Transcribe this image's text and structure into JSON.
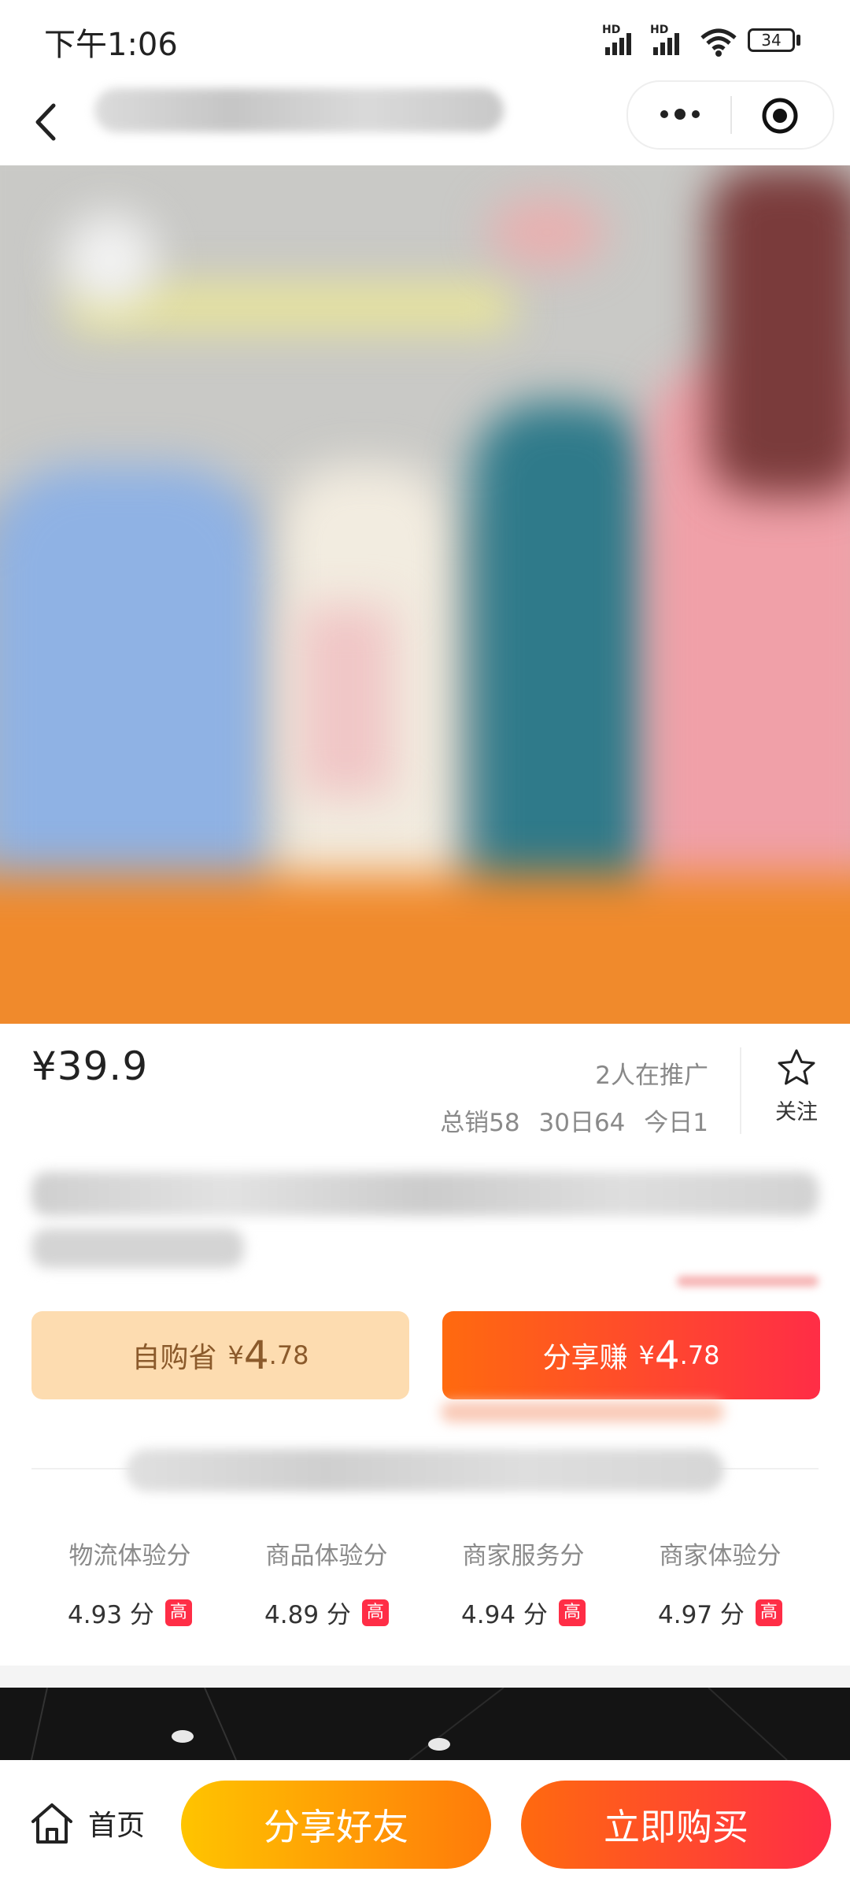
{
  "status_bar": {
    "time": "下午1:06",
    "battery": "34",
    "signal_tag": "HD"
  },
  "nav": {
    "back_icon": "chevron-left-icon",
    "more_icon": "more-dots-icon",
    "close_icon": "target-circle-icon"
  },
  "product": {
    "price": "¥39.9",
    "promoters": "2人在推广",
    "sales_total": "总销58",
    "sales_30d": "30日64",
    "sales_today": "今日1",
    "favorite_label": "关注",
    "favorite_icon": "star-outline-icon"
  },
  "actions": {
    "self_buy_label": "自购省",
    "self_buy_currency": "¥",
    "self_buy_int": "4",
    "self_buy_dec": ".78",
    "share_label": "分享赚",
    "share_currency": "¥",
    "share_int": "4",
    "share_dec": ".78"
  },
  "scores": [
    {
      "name": "物流体验分",
      "value": "4.93 分",
      "badge": "高"
    },
    {
      "name": "商品体验分",
      "value": "4.89 分",
      "badge": "高"
    },
    {
      "name": "商家服务分",
      "value": "4.94 分",
      "badge": "高"
    },
    {
      "name": "商家体验分",
      "value": "4.97 分",
      "badge": "高"
    }
  ],
  "bottom_bar": {
    "home_label": "首页",
    "home_icon": "home-icon",
    "share_button": "分享好友",
    "buy_button": "立即购买"
  },
  "colors": {
    "accent_red": "#ff2d46",
    "accent_orange": "#ff6a0f",
    "accent_yellow": "#ffc400",
    "save_bg": "#fddcb0",
    "save_text": "#8b5a2b"
  }
}
